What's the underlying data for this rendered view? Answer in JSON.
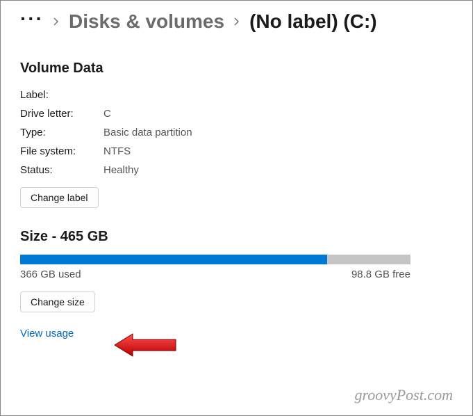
{
  "breadcrumb": {
    "parent": "Disks & volumes",
    "current": "(No label) (C:)"
  },
  "volume_data": {
    "title": "Volume Data",
    "label_key": "Label:",
    "label_value": "",
    "drive_letter_key": "Drive letter:",
    "drive_letter_value": "C",
    "type_key": "Type:",
    "type_value": "Basic data partition",
    "file_system_key": "File system:",
    "file_system_value": "NTFS",
    "status_key": "Status:",
    "status_value": "Healthy",
    "change_label_btn": "Change label"
  },
  "size": {
    "title": "Size - 465 GB",
    "used_text": "366 GB used",
    "free_text": "98.8 GB free",
    "used_percent": 78.7,
    "change_size_btn": "Change size",
    "view_usage_link": "View usage"
  },
  "watermark": "groovyPost.com"
}
